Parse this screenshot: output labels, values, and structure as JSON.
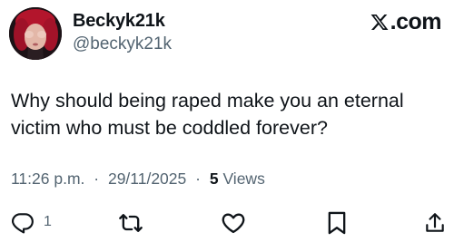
{
  "user": {
    "display_name": "Beckyk21k",
    "handle": "@beckyk21k",
    "avatar_icon": "profile-photo"
  },
  "brand": {
    "label": ".com",
    "icon": "x-logo"
  },
  "tweet": {
    "text": "Why should being raped make you an eternal victim who must be coddled forever?"
  },
  "meta": {
    "time": "11:26 p.m.",
    "separator": "·",
    "date": "29/11/2025",
    "views_count": "5",
    "views_label": "Views"
  },
  "actions": {
    "reply_icon": "reply-icon",
    "reply_count": "1",
    "retweet_icon": "retweet-icon",
    "like_icon": "heart-icon",
    "bookmark_icon": "bookmark-icon",
    "share_icon": "share-icon"
  },
  "colors": {
    "text": "#0f1419",
    "secondary": "#536471",
    "background": "#ffffff"
  }
}
